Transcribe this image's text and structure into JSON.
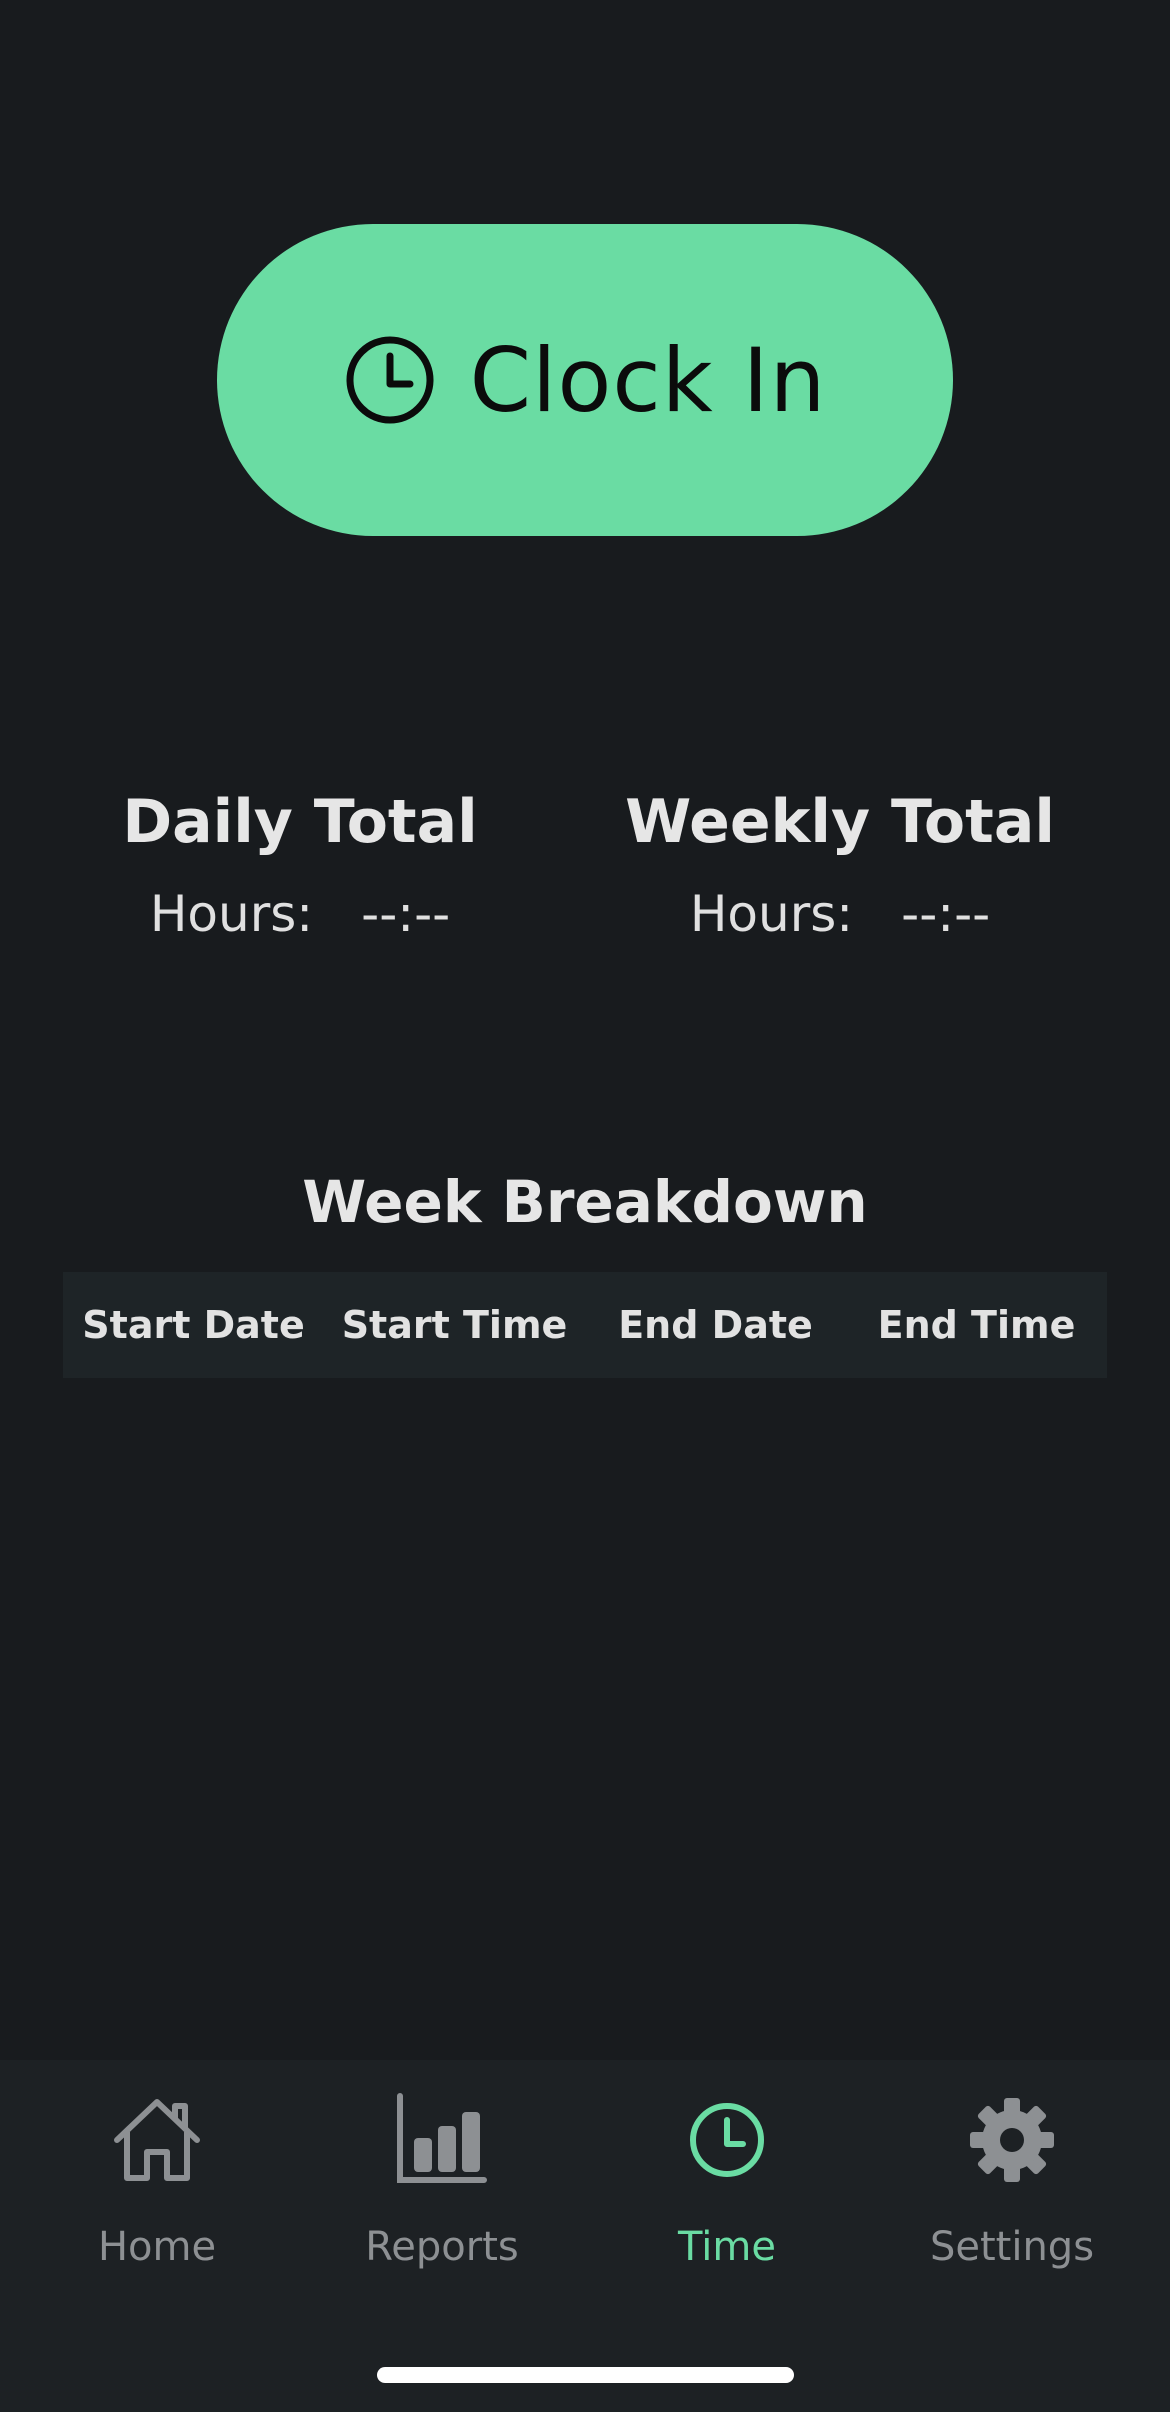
{
  "clock_button": {
    "label": "Clock In",
    "icon": "clock-icon",
    "color": "#6adca3"
  },
  "totals": {
    "daily": {
      "title": "Daily Total",
      "hours_label": "Hours:",
      "hours_value": "--:--"
    },
    "weekly": {
      "title": "Weekly Total",
      "hours_label": "Hours:",
      "hours_value": "--:--"
    }
  },
  "breakdown": {
    "title": "Week Breakdown",
    "columns": [
      "Start Date",
      "Start Time",
      "End Date",
      "End Time"
    ]
  },
  "tabbar": {
    "items": [
      {
        "label": "Home",
        "icon": "home-icon",
        "active": false
      },
      {
        "label": "Reports",
        "icon": "bar-chart-icon",
        "active": false
      },
      {
        "label": "Time",
        "icon": "clock-icon",
        "active": true
      },
      {
        "label": "Settings",
        "icon": "gear-icon",
        "active": false
      }
    ],
    "active_color": "#6adca3",
    "inactive_color": "#8d9093"
  }
}
